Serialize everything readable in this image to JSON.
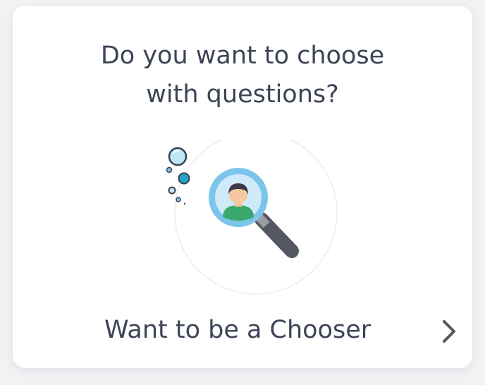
{
  "card": {
    "question_line_1": "Do you want to choose",
    "question_line_2": "with questions?",
    "cta_label": "Want to be a Chooser"
  },
  "icons": {
    "illustration": "magnifier-person-icon",
    "arrow": "chevron-right-icon"
  },
  "colors": {
    "text": "#3d4457",
    "lens_ring": "#7cc4ea",
    "lens_inner": "#cfeaf8",
    "handle": "#555861",
    "bubble_accent": "#21a4c8"
  }
}
